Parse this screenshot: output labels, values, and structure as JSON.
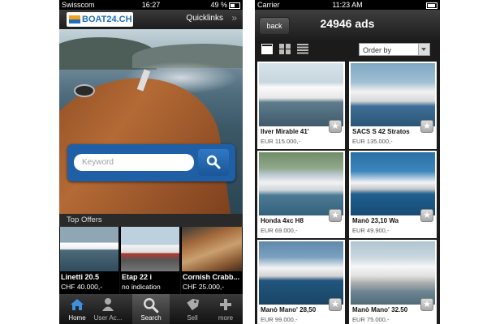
{
  "left_screen": {
    "status_bar": {
      "carrier": "Swisscom",
      "time": "16:27",
      "battery": "49 %"
    },
    "header": {
      "logo_text": "BOAT24.CH",
      "quicklinks_label": "Quicklinks",
      "quicklinks_arrow": "»"
    },
    "search": {
      "placeholder": "Keyword"
    },
    "top_offers": {
      "title": "Top Offers",
      "items": [
        {
          "name": "Linetti 20.5",
          "price": "CHF 40.000,-"
        },
        {
          "name": "Etap 22 i",
          "price": "no indication"
        },
        {
          "name": "Cornish Crabb...",
          "price": "CHF 25.000,-"
        }
      ]
    },
    "tab_bar": [
      {
        "label": "Home",
        "icon": "home-icon"
      },
      {
        "label": "User Ac...",
        "icon": "user-icon"
      },
      {
        "label": "Search",
        "icon": "search-icon"
      },
      {
        "label": "Sell",
        "icon": "tag-icon"
      },
      {
        "label": "more",
        "icon": "plus-icon"
      }
    ]
  },
  "right_screen": {
    "status_bar": {
      "carrier": "Carrier",
      "time": "11:23 AM"
    },
    "header": {
      "back_label": "back",
      "ads_count": "24946 ads"
    },
    "toolbar": {
      "views": [
        "list-view-icon",
        "grid-view-icon",
        "compact-list-icon"
      ],
      "order_by": "Order by"
    },
    "ads": [
      {
        "title": "llver Mirable 41'",
        "price": "EUR 115.000,-"
      },
      {
        "title": "SACS S 42 Stratos",
        "price": "EUR 135.000,-"
      },
      {
        "title": "Honda 4xc H8",
        "price": "EUR 69.000,-"
      },
      {
        "title": "Manò 23,10 Wa",
        "price": "EUR 49.900,-"
      },
      {
        "title": "Manò Mano' 28,50",
        "price": "EUR 99.000,-"
      },
      {
        "title": "Manò Mano' 32.50",
        "price": "EUR 75.000,-"
      }
    ],
    "favorite_icon": "star-icon"
  },
  "colors": {
    "accent_blue": "#1f5fa6",
    "logo_orange": "#f3a21a",
    "dark_bar": "#1c1c1c"
  }
}
